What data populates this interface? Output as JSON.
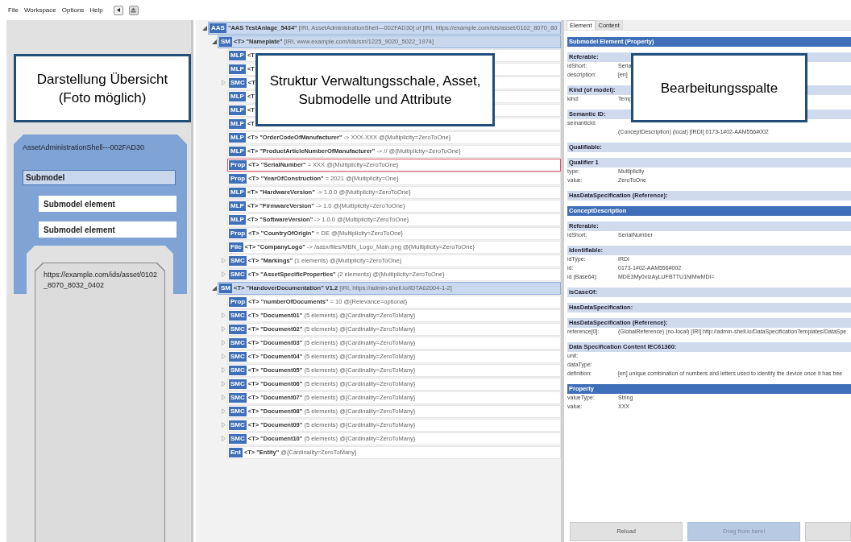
{
  "menu": [
    "File",
    "Workspace",
    "Options",
    "Help"
  ],
  "overview": {
    "aas_label": "AssetAdministrationShell---002FAD30",
    "submodel": "Submodel",
    "elements": [
      "Submodel element",
      "Submodel element"
    ],
    "asset_url": "https://example.com/ids/asset/0102_8070_8032_0402"
  },
  "tree": [
    {
      "tag": "AAS",
      "name": "\"AAS TestAnlage_5434\"",
      "detail": "[IRI, AssetAdministrationShell---002FAD30] of [IRI, https://example.com/ids/asset/0102_8070_80",
      "expanded": true,
      "selected": false,
      "children": [
        {
          "tag": "SM",
          "name": "<T> \"Nameplate\"",
          "detail": "[IRI, www.example.com/ids/sm/1225_9020_5022_1974]",
          "expanded": true,
          "selected": false,
          "children": [
            {
              "tag": "MLP",
              "name": "<T",
              "selected": false
            },
            {
              "tag": "MLP",
              "name": "<T",
              "selected": false
            },
            {
              "tag": "SMC",
              "name": "<T",
              "expanded": false,
              "selected": false
            },
            {
              "tag": "MLP",
              "name": "<T",
              "selected": false
            },
            {
              "tag": "MLP",
              "name": "<T",
              "selected": false
            },
            {
              "tag": "MLP",
              "name": "<T",
              "selected": false
            },
            {
              "tag": "MLP",
              "name": "<T> \"OrderCodeOfManufacturer\"",
              "detail": "-> XXX-XXX @{Multiplicity=ZeroToOne}",
              "selected": false
            },
            {
              "tag": "MLP",
              "name": "<T> \"ProductArticleNumberOfManufacturer\"",
              "detail": "-> // @{Multiplicity=ZeroToOne}",
              "selected": false
            },
            {
              "tag": "Prop",
              "name": "<T> \"SerialNumber\"",
              "detail": "= XXX @{Multiplicity=ZeroToOne}",
              "selected": true
            },
            {
              "tag": "Prop",
              "name": "<T> \"YearOfConstruction\"",
              "detail": "= 2021 @{Multiplicity=One}",
              "selected": false
            },
            {
              "tag": "MLP",
              "name": "<T> \"HardwareVersion\"",
              "detail": "-> 1.0.0 @{Multiplicity=ZeroToOne}",
              "selected": false
            },
            {
              "tag": "MLP",
              "name": "<T> \"FirmwareVersion\"",
              "detail": "-> 1.0 @{Multiplicity=ZeroToOne}",
              "selected": false
            },
            {
              "tag": "MLP",
              "name": "<T> \"SoftwareVersion\"",
              "detail": "-> 1.0.0 @{Multiplicity=ZeroToOne}",
              "selected": false
            },
            {
              "tag": "Prop",
              "name": "<T> \"CountryOfOrigin\"",
              "detail": "= DE @{Multiplicity=ZeroToOne}",
              "selected": false
            },
            {
              "tag": "File",
              "name": "<T> \"CompanyLogo\"",
              "detail": "-> /aasx/files/MBN_Logo_Main.png @{Multiplicity=ZeroToOne}",
              "selected": false
            },
            {
              "tag": "SMC",
              "name": "<T> \"Markings\"",
              "detail": "(1 elements) @{Multiplicity=ZeroToOne}",
              "expanded": false,
              "selected": false
            },
            {
              "tag": "SMC",
              "name": "<T> \"AssetSpecificProperties\"",
              "detail": "(2 elements) @{Multiplicity=ZeroToOne}",
              "expanded": false,
              "selected": false
            }
          ]
        },
        {
          "tag": "SM",
          "name": "<T> \"HandoverDocumentation\" V1.2",
          "detail": "[IRI, https://admin-shell.io/IDTA02004-1-2]",
          "expanded": true,
          "selected": false,
          "children": [
            {
              "tag": "Prop",
              "name": "<T> \"numberOfDocuments\"",
              "detail": "= 10 @{Relevance=optional}",
              "selected": false
            },
            {
              "tag": "SMC",
              "name": "<T> \"Document01\"",
              "detail": "(5 elements) @{Cardinality=ZeroToMany}",
              "expanded": false,
              "selected": false
            },
            {
              "tag": "SMC",
              "name": "<T> \"Document02\"",
              "detail": "(5 elements) @{Cardinality=ZeroToMany}",
              "expanded": false,
              "selected": false
            },
            {
              "tag": "SMC",
              "name": "<T> \"Document03\"",
              "detail": "(5 elements) @{Cardinality=ZeroToMany}",
              "expanded": false,
              "selected": false
            },
            {
              "tag": "SMC",
              "name": "<T> \"Document04\"",
              "detail": "(5 elements) @{Cardinality=ZeroToMany}",
              "expanded": false,
              "selected": false
            },
            {
              "tag": "SMC",
              "name": "<T> \"Document05\"",
              "detail": "(5 elements) @{Cardinality=ZeroToMany}",
              "expanded": false,
              "selected": false
            },
            {
              "tag": "SMC",
              "name": "<T> \"Document06\"",
              "detail": "(5 elements) @{Cardinality=ZeroToMany}",
              "expanded": false,
              "selected": false
            },
            {
              "tag": "SMC",
              "name": "<T> \"Document07\"",
              "detail": "(5 elements) @{Cardinality=ZeroToMany}",
              "expanded": false,
              "selected": false
            },
            {
              "tag": "SMC",
              "name": "<T> \"Document08\"",
              "detail": "(5 elements) @{Cardinality=ZeroToMany}",
              "expanded": false,
              "selected": false
            },
            {
              "tag": "SMC",
              "name": "<T> \"Document09\"",
              "detail": "(5 elements) @{Cardinality=ZeroToMany}",
              "expanded": false,
              "selected": false
            },
            {
              "tag": "SMC",
              "name": "<T> \"Document10\"",
              "detail": "(5 elements) @{Cardinality=ZeroToMany}",
              "expanded": false,
              "selected": false
            },
            {
              "tag": "Ent",
              "name": "<T> \"Entity\"",
              "detail": "@{Cardinality=ZeroToMany}",
              "selected": false
            }
          ]
        }
      ]
    }
  ],
  "editor": {
    "tabs": [
      {
        "label": "Element",
        "selected": true
      },
      {
        "label": "Content",
        "selected": false
      }
    ],
    "sections": [
      {
        "kind": "title",
        "label": "Submodel Element (Property)"
      },
      {
        "kind": "section",
        "label": "Referable:",
        "rows": [
          {
            "key": "idShort:",
            "value": "Seria"
          },
          {
            "key": "description:",
            "value": "[en]"
          }
        ]
      },
      {
        "kind": "section",
        "label": "Kind (of model):",
        "rows": [
          {
            "key": "kind:",
            "value": "Temp"
          }
        ]
      },
      {
        "kind": "section",
        "label": "Semantic ID:",
        "rows": [
          {
            "key": "semanticId:"
          },
          {
            "value": "(ConceptDescription) (local) [IRDI] 0173-1#02-AAM556#002"
          }
        ]
      },
      {
        "kind": "section",
        "label": "Qualifiable:"
      },
      {
        "kind": "section",
        "label": "Qualifier 1",
        "rows": [
          {
            "key": "type:",
            "value": "Multiplicity"
          },
          {
            "key": "value:",
            "value": "ZeroToOne"
          }
        ]
      },
      {
        "kind": "section",
        "label": "HasDataSpecification (Reference):"
      },
      {
        "kind": "title",
        "label": "ConceptDescription"
      },
      {
        "kind": "section",
        "label": "Referable:",
        "rows": [
          {
            "key": "idShort:",
            "value": "SerialNumber"
          }
        ]
      },
      {
        "kind": "section",
        "label": "Identifiable:",
        "rows": [
          {
            "key": "idType:",
            "value": "IRDI"
          },
          {
            "key": "id:",
            "value": "0173-1#02-AAM556#002"
          },
          {
            "key": "id (Base64):",
            "value": "MDE3My0xIzAyLUFBTTU1NiMwMDI="
          }
        ]
      },
      {
        "kind": "section",
        "label": "isCaseOf:"
      },
      {
        "kind": "section",
        "label": "HasDataSpecification:"
      },
      {
        "kind": "section",
        "label": "HasDataSpecification (Reference):",
        "rows": [
          {
            "key": "reference[0]:",
            "value": "(GlobalReference) (no-local) [IRI] http://admin-shell.io/DataSpecificationTemplates/DataSpe"
          }
        ]
      },
      {
        "kind": "section",
        "label": "Data Specification Content IEC61360:",
        "rows": [
          {
            "key": "unit:"
          },
          {
            "key": "dataType:"
          },
          {
            "key": "definition:",
            "value": "[en] unique combination of numbers and letters used to identify the device once it has bee"
          }
        ]
      },
      {
        "kind": "title",
        "label": "Property",
        "rows": [
          {
            "key": "valueType:",
            "value": "String"
          },
          {
            "key": "value:",
            "value": "XXX"
          }
        ]
      }
    ],
    "buttons": [
      {
        "label": "Reload",
        "disabled": false
      },
      {
        "label": "Drag from here!",
        "disabled": true
      }
    ]
  },
  "callouts": [
    {
      "text": "Darstellung Übersicht (Foto möglich)"
    },
    {
      "text": "Struktur Verwaltungsschale, Asset, Submodelle und Attribute"
    },
    {
      "text": "Bearbeitungsspalte"
    }
  ]
}
